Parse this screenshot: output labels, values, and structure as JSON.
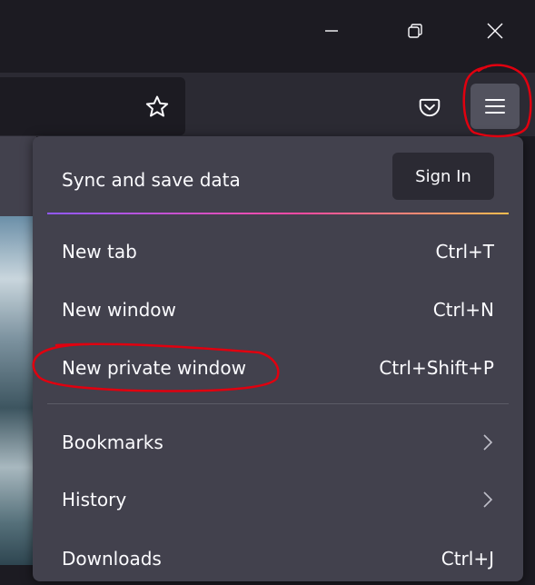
{
  "window_controls": {
    "minimize_icon": "minimize-icon",
    "restore_icon": "restore-icon",
    "close_icon": "close-icon"
  },
  "toolbar": {
    "bookmark_icon": "star-icon",
    "pocket_icon": "pocket-icon",
    "menu_icon": "hamburger-menu-icon"
  },
  "menu": {
    "sync_label": "Sync and save data",
    "signin_label": "Sign In",
    "items": [
      {
        "label": "New tab",
        "shortcut": "Ctrl+T"
      },
      {
        "label": "New window",
        "shortcut": "Ctrl+N"
      },
      {
        "label": "New private window",
        "shortcut": "Ctrl+Shift+P"
      },
      {
        "label": "Bookmarks"
      },
      {
        "label": "History"
      },
      {
        "label": "Downloads",
        "shortcut": "Ctrl+J"
      }
    ]
  },
  "colors": {
    "titlebar": "#1c1b22",
    "toolbar": "#2b2a33",
    "menu_panel": "#42414d",
    "annotation": "#e0000f"
  }
}
